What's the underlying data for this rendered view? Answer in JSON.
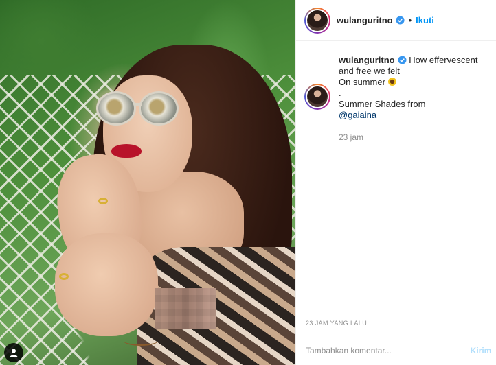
{
  "post": {
    "author": "wulanguritno",
    "follow_label": "Ikuti",
    "separator": "•",
    "caption": {
      "line1": "How effervescent",
      "line2": "and free we felt",
      "line3": "On summer",
      "line4": ".",
      "line5": "Summer Shades from",
      "mention": "@gaiaina"
    },
    "caption_time": "23 jam",
    "timestamp": "23 JAM YANG LALU"
  },
  "comment": {
    "placeholder": "Tambahkan komentar...",
    "submit_label": "Kirim"
  },
  "colors": {
    "accent": "#0095f6",
    "link": "#00376b",
    "muted": "#8e8e8e",
    "submit_disabled": "#b2dffc"
  },
  "icons": {
    "verified": "verified-badge-icon",
    "user_tag": "user-tag-icon",
    "emoji": "sunflower-emoji"
  }
}
